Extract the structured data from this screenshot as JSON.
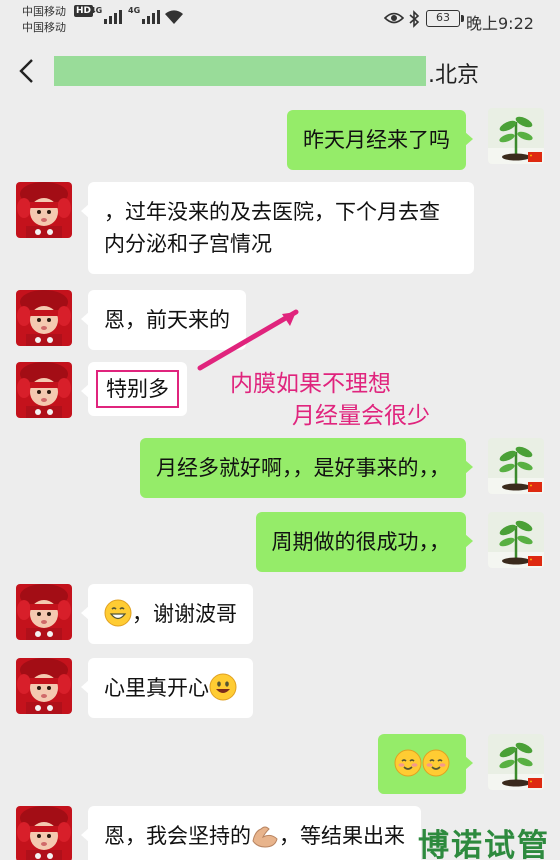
{
  "status_bar": {
    "carrier_1": "中国移动",
    "carrier_2": "中国移动",
    "hd_badge": "HD",
    "network_1": "4G",
    "network_2": "4G",
    "battery": "63",
    "time": "晚上9:22"
  },
  "header": {
    "title_suffix": ".北京"
  },
  "messages": [
    {
      "side": "right",
      "text": "昨天月经来了吗"
    },
    {
      "side": "left",
      "text": "，过年没来的及去医院，下个月去查内分泌和子宫情况"
    },
    {
      "side": "left",
      "text": "恩，前天来的"
    },
    {
      "side": "left",
      "text": "特别多"
    },
    {
      "side": "right",
      "text": "月经多就好啊，，是好事来的，，"
    },
    {
      "side": "right",
      "text": "周期做的很成功，，"
    },
    {
      "side": "left",
      "text": "，谢谢波哥",
      "emoji": "grin"
    },
    {
      "side": "left",
      "text": "心里真开心",
      "emoji": "smile"
    },
    {
      "side": "right",
      "text": "",
      "emoji": "blush-blush"
    },
    {
      "side": "left",
      "text_before": "恩，我会坚持的",
      "text_after": "，等结果出来",
      "emoji": "muscle"
    }
  ],
  "annotation": {
    "line_1": "内膜如果不理想",
    "line_2": "月经量会很少",
    "color": "#e0247d"
  },
  "watermark": "博诺试管",
  "colors": {
    "background": "#ededed",
    "right_bubble": "#95ec69",
    "left_bubble": "#ffffff",
    "redacted_name": "#99dc99"
  }
}
